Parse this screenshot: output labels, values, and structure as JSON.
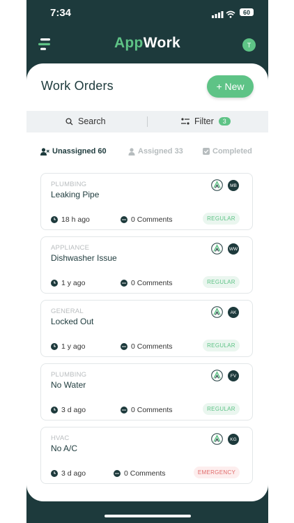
{
  "status": {
    "time": "7:34",
    "battery": "60"
  },
  "header": {
    "logo_a": "App",
    "logo_b": "Work",
    "avatar": "T"
  },
  "page": {
    "title": "Work Orders",
    "new_label": "+ New"
  },
  "toolbar": {
    "search_label": "Search",
    "filter_label": "Filter",
    "filter_count": "3"
  },
  "tabs": [
    {
      "label": "Unassigned 60",
      "state": "active"
    },
    {
      "label": "Assigned 33",
      "state": "inactive"
    },
    {
      "label": "Completed",
      "state": "inactive"
    }
  ],
  "orders": [
    {
      "category": "PLUMBING",
      "title": "Leaking Pipe",
      "age": "18 h ago",
      "comments": "0 Comments",
      "priority": "REGULAR",
      "initials": "MB"
    },
    {
      "category": "APPLIANCE",
      "title": "Dishwasher Issue",
      "age": "1 y ago",
      "comments": "0 Comments",
      "priority": "REGULAR",
      "initials": "WW"
    },
    {
      "category": "GENERAL",
      "title": "Locked Out",
      "age": "1 y ago",
      "comments": "0 Comments",
      "priority": "REGULAR",
      "initials": "AK"
    },
    {
      "category": "PLUMBING",
      "title": "No Water",
      "age": "3 d ago",
      "comments": "0 Comments",
      "priority": "REGULAR",
      "initials": "FV"
    },
    {
      "category": "HVAC",
      "title": "No A/C",
      "age": "3 d ago",
      "comments": "0 Comments",
      "priority": "EMERGENCY",
      "initials": "KG"
    }
  ],
  "colors": {
    "brand_dark": "#1d3a3c",
    "accent": "#5ec386",
    "emergency": "#e06a6a"
  }
}
